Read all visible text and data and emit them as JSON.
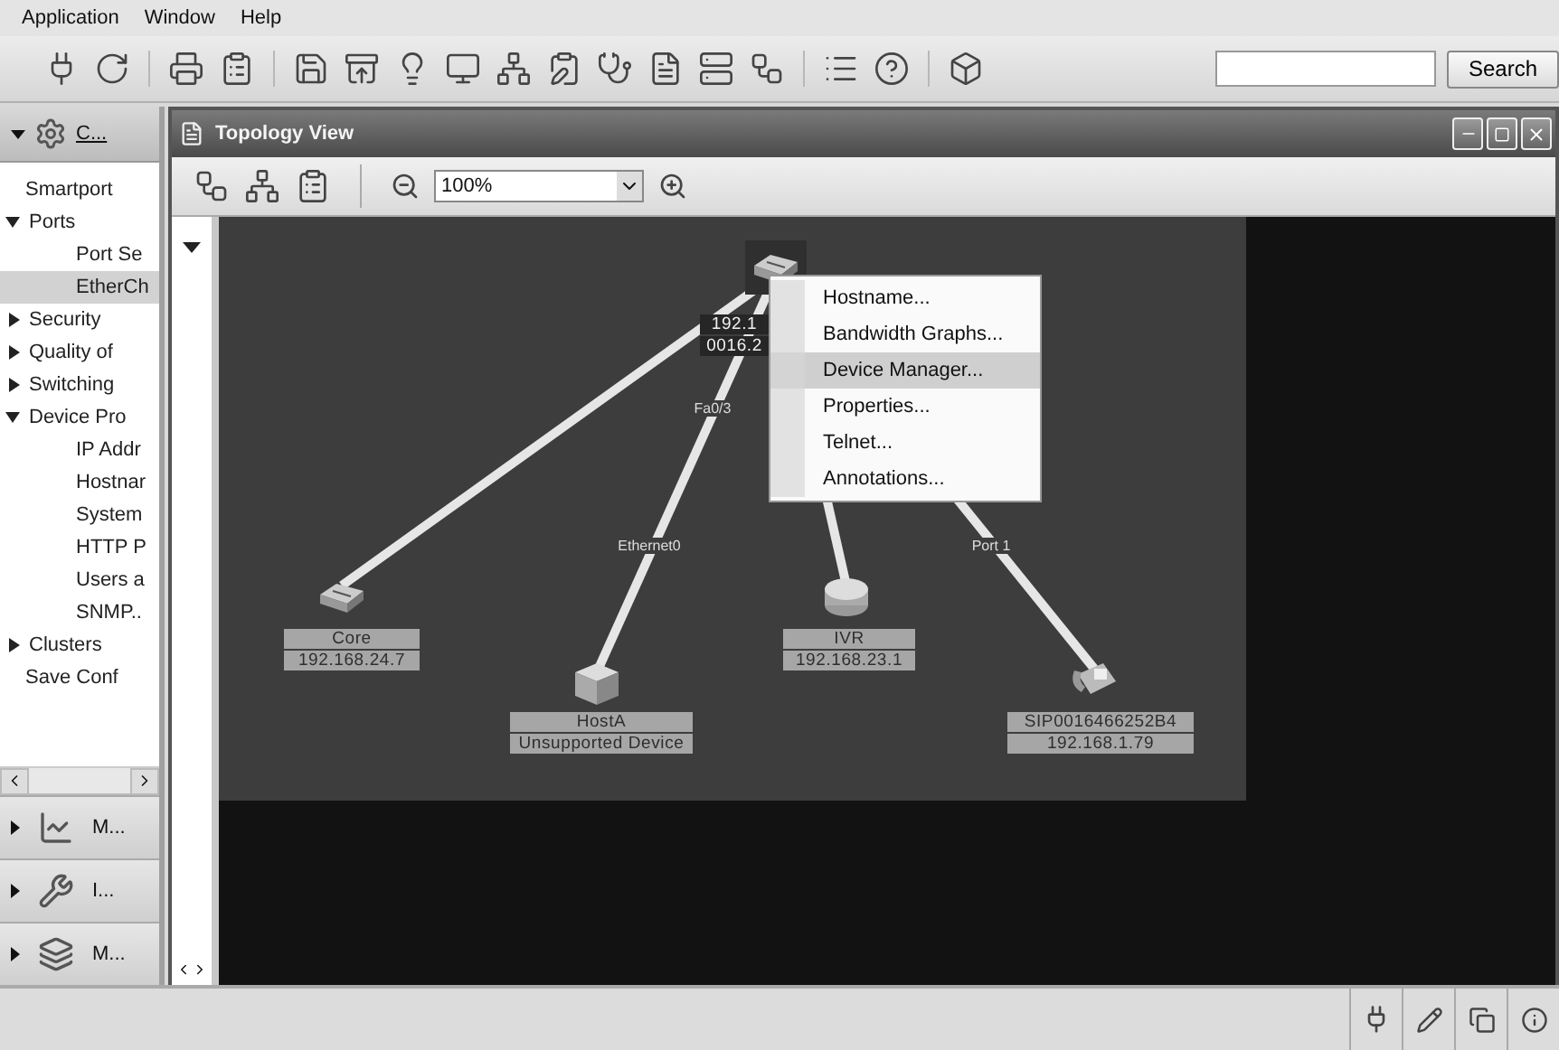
{
  "menubar": [
    "Application",
    "Window",
    "Help"
  ],
  "search": {
    "button": "Search"
  },
  "sidebar": {
    "header": "C...",
    "tree": [
      {
        "label": "Smartport",
        "selected": false
      },
      {
        "label": "Ports",
        "selected": false,
        "expanded": true,
        "children": [
          {
            "label": "Port Se",
            "selected": false
          },
          {
            "label": "EtherCh",
            "selected": true
          }
        ]
      },
      {
        "label": "Security",
        "selected": false,
        "expanded": false
      },
      {
        "label": "Quality of",
        "selected": false,
        "expanded": false
      },
      {
        "label": "Switching",
        "selected": false,
        "expanded": false
      },
      {
        "label": "Device Pro",
        "selected": false,
        "expanded": true,
        "children": [
          {
            "label": "IP Addr",
            "selected": false
          },
          {
            "label": "Hostnar",
            "selected": false
          },
          {
            "label": "System",
            "selected": false
          },
          {
            "label": "HTTP P",
            "selected": false
          },
          {
            "label": "Users a",
            "selected": false
          },
          {
            "label": "SNMP..",
            "selected": false
          }
        ]
      },
      {
        "label": "Clusters",
        "selected": false,
        "expanded": false
      },
      {
        "label": "Save Conf",
        "selected": false
      }
    ],
    "sections": [
      {
        "label": "M..."
      },
      {
        "label": "I..."
      },
      {
        "label": "M..."
      }
    ]
  },
  "topology": {
    "title": "Topology View",
    "zoom": "100%",
    "nodes": [
      {
        "kind": "switch",
        "selected": true,
        "labels": [
          "192.1",
          "0016.2"
        ]
      },
      {
        "kind": "switch",
        "selected": false,
        "labels": [
          "Core",
          "192.168.24.7"
        ]
      },
      {
        "kind": "unknown",
        "selected": false,
        "labels": [
          "HostA",
          "Unsupported Device"
        ]
      },
      {
        "kind": "router",
        "selected": false,
        "labels": [
          "IVR",
          "192.168.23.1"
        ]
      },
      {
        "kind": "phone",
        "selected": false,
        "labels": [
          "SIP0016466252B4",
          "192.168.1.79"
        ]
      }
    ],
    "link_labels": [
      "Fa0/3",
      "Ethernet0",
      "Port 1"
    ],
    "context_menu": [
      {
        "label": "Hostname...",
        "selected": false
      },
      {
        "label": "Bandwidth Graphs...",
        "selected": false
      },
      {
        "label": "Device Manager...",
        "selected": true
      },
      {
        "label": "Properties...",
        "selected": false
      },
      {
        "label": "Telnet...",
        "selected": false
      },
      {
        "label": "Annotations...",
        "selected": false
      }
    ]
  }
}
